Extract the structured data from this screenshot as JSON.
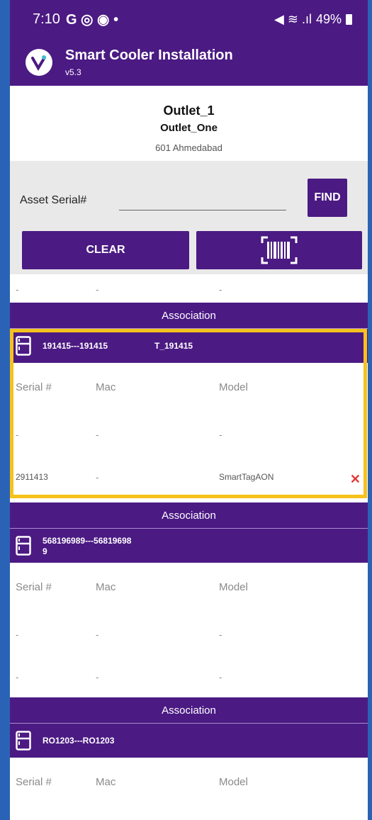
{
  "status_bar": {
    "time": "7:10",
    "left_icons": "G ◎ ◉ •",
    "right_icons": "◀ ≋ .ıl",
    "battery": "49%"
  },
  "app": {
    "title": "Smart Cooler Installation",
    "version": "v5.3"
  },
  "outlet": {
    "name": "Outlet_1",
    "code": "Outlet_One",
    "address": "601 Ahmedabad"
  },
  "search": {
    "label": "Asset Serial#",
    "input_value": "",
    "find_label": "FIND",
    "clear_label": "CLEAR"
  },
  "top_row": [
    "-",
    "-",
    "-"
  ],
  "associations": [
    {
      "section_label": "Association",
      "asset_id": "191415---191415",
      "asset_name": "T_191415",
      "headers": [
        "Serial #",
        "Mac",
        "Model"
      ],
      "rows": [
        [
          "-",
          "-",
          "-"
        ],
        [
          "2911413",
          "-",
          "SmartTagAON"
        ]
      ],
      "remove_icon": "✕"
    },
    {
      "section_label": "Association",
      "asset_id": "568196989---56819698",
      "asset_id_wrap": "9",
      "headers": [
        "Serial #",
        "Mac",
        "Model"
      ],
      "rows": [
        [
          "-",
          "-",
          "-"
        ],
        [
          "-",
          "-",
          "-"
        ]
      ]
    },
    {
      "section_label": "Association",
      "asset_id": "RO1203---RO1203",
      "headers": [
        "Serial #",
        "Mac",
        "Model"
      ],
      "rows": [
        [
          "-",
          "-",
          "-"
        ]
      ]
    }
  ],
  "colors": {
    "primary": "#4b1a83",
    "highlight": "#f6c21c",
    "remove": "#e53935",
    "frame": "#2a63b6"
  }
}
